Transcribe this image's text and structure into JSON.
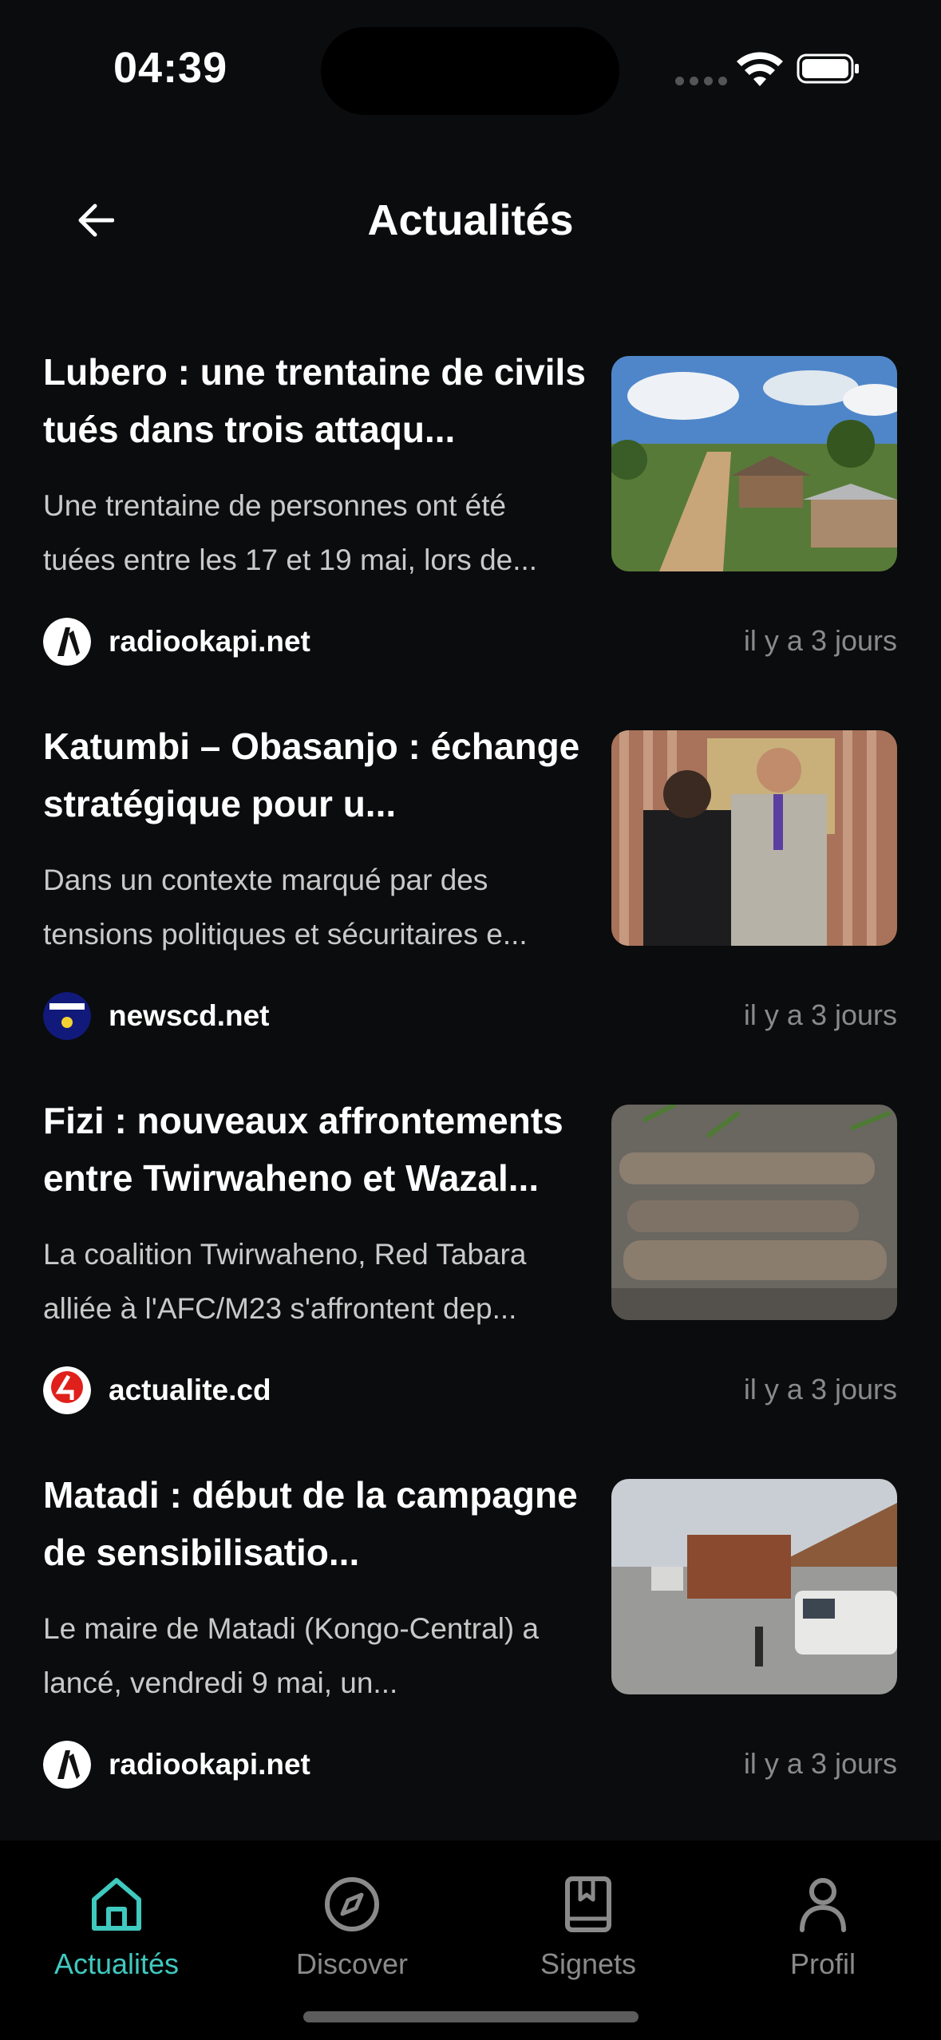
{
  "status_bar": {
    "time": "04:39"
  },
  "header": {
    "title": "Actualités"
  },
  "articles": [
    {
      "title": "Lubero : une trentaine de civils tués dans trois attaqu...",
      "description": "Une trentaine de personnes ont été tuées entre les 17 et 19 mai, lors de...",
      "source": "radiookapi.net",
      "time": "il y a 3 jours",
      "thumb": "village-photo"
    },
    {
      "title": "Katumbi – Obasanjo : échange stratégique pour u...",
      "description": "Dans un contexte marqué par des tensions politiques et sécuritaires e...",
      "source": "newscd.net",
      "time": "il y a 3 jours",
      "thumb": "handshake-photo"
    },
    {
      "title": "Fizi : nouveaux affrontements entre Twirwaheno et Wazal...",
      "description": "La coalition Twirwaheno, Red Tabara alliée à l'AFC/M23 s'affrontent dep...",
      "source": "actualite.cd",
      "time": "il y a 3 jours",
      "thumb": "shells-photo"
    },
    {
      "title": "Matadi : début de la campagne de sensibilisatio...",
      "description": "Le maire de Matadi (Kongo-Central) a lancé, vendredi 9 mai, un...",
      "source": "radiookapi.net",
      "time": "il y a 3 jours",
      "thumb": "road-trucks-photo"
    }
  ],
  "tabs": [
    {
      "label": "Actualités",
      "icon": "home-icon",
      "active": true
    },
    {
      "label": "Discover",
      "icon": "compass-icon",
      "active": false
    },
    {
      "label": "Signets",
      "icon": "bookmark-icon",
      "active": false
    },
    {
      "label": "Profil",
      "icon": "person-icon",
      "active": false
    }
  ],
  "colors": {
    "accent": "#3fc9bf",
    "background": "#0b0c0d",
    "tab_bar": "#000000",
    "muted": "#8a8a8a"
  }
}
